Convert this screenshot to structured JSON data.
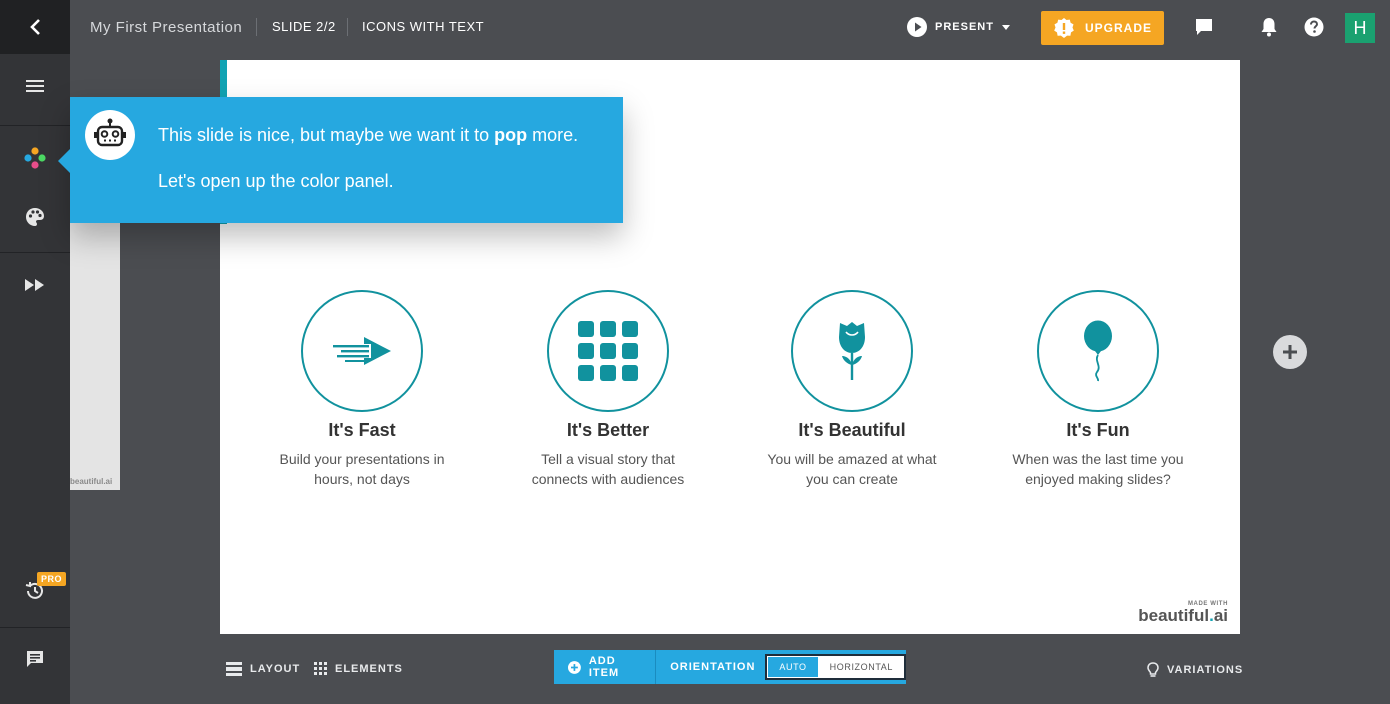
{
  "topbar": {
    "presentation_title": "My First Presentation",
    "slide_counter": "SLIDE 2/2",
    "slide_layout": "ICONS WITH TEXT",
    "present_label": "PRESENT",
    "upgrade_label": "UPGRADE",
    "avatar_initial": "H"
  },
  "sidebar": {
    "pro_badge": "PRO"
  },
  "tooltip": {
    "line1_before": "This slide is nice, but maybe we want it to ",
    "line1_bold": "pop",
    "line1_after": " more.",
    "line2": "Let's open up the color panel."
  },
  "slide": {
    "items": [
      {
        "icon": "fast-arrow-icon",
        "title": "It's Fast",
        "desc_line1": "Build your presentations in",
        "desc_line2": "hours, not days"
      },
      {
        "icon": "grid-icon",
        "title": "It's Better",
        "desc_line1": "Tell a visual story that",
        "desc_line2": "connects with audiences"
      },
      {
        "icon": "rose-icon",
        "title": "It's Beautiful",
        "desc_line1": "You will be amazed at what",
        "desc_line2": "you can create"
      },
      {
        "icon": "balloon-icon",
        "title": "It's Fun",
        "desc_line1": "When was the last time you",
        "desc_line2": "enjoyed making slides?"
      }
    ],
    "made_with_label": "MADE WITH",
    "brand_prefix": "beautiful",
    "brand_dot": ".",
    "brand_suffix": "ai"
  },
  "thumbnail": {
    "brand": "beautiful.ai"
  },
  "bottombar": {
    "layout_label": "LAYOUT",
    "elements_label": "ELEMENTS",
    "add_item_label": "ADD ITEM",
    "orientation_label": "ORIENTATION",
    "orientation_auto": "AUTO",
    "orientation_horizontal": "HORIZONTAL",
    "variations_label": "VARIATIONS"
  },
  "colors": {
    "accent": "#11a3b3",
    "tooltip_blue": "#26a8e0",
    "upgrade_orange": "#f5a623",
    "avatar_green": "#1aa170"
  }
}
